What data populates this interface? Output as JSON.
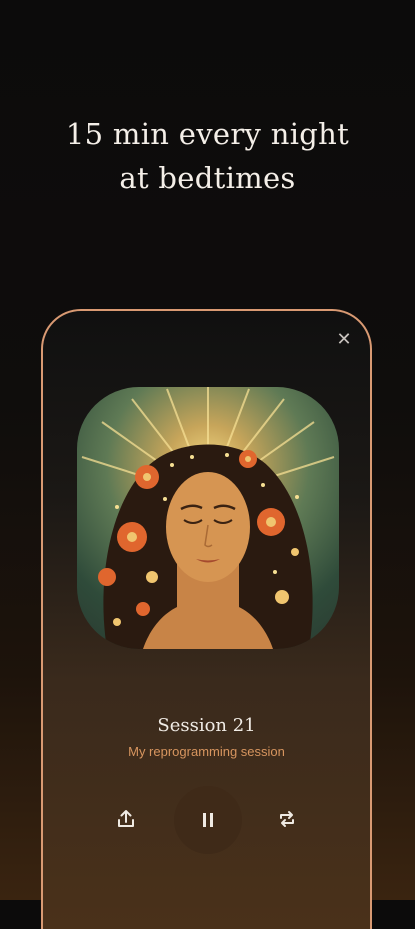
{
  "headline": {
    "line1": "15 min every night",
    "line2": "at bedtimes"
  },
  "player": {
    "close_icon": "close-icon",
    "artwork": "meditation-woman-with-flowers-artwork",
    "session_title": "Session 21",
    "session_subtitle": "My reprogramming session",
    "controls": {
      "share_icon": "share-icon",
      "pause_icon": "pause-icon",
      "repeat_icon": "repeat-icon"
    }
  },
  "colors": {
    "accent": "#d7955f",
    "frame_border": "#d99a73",
    "play_button_bg": "#3f2a18"
  }
}
